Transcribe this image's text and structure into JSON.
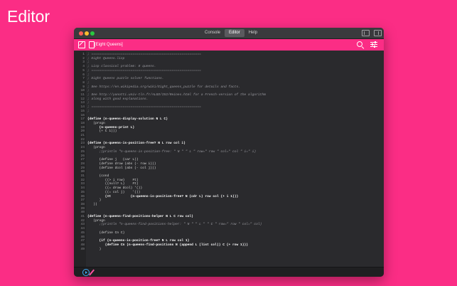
{
  "page": {
    "title": "Editor"
  },
  "window": {
    "tabs": [
      "Console",
      "Editor",
      "Help"
    ],
    "active_tab": "Editor",
    "document_title": "[Eight Queens]"
  },
  "colors": {
    "background": "#fb2d85",
    "window": "#2a2a2d",
    "accent": "#fb2d85",
    "run": "#3fa9f5"
  },
  "icons": {
    "toolbar_left": [
      "edit-icon",
      "file-icon"
    ],
    "toolbar_right": [
      "search-icon",
      "sliders-icon"
    ],
    "titlebar_right": [
      "sidebar-left-icon",
      "sidebar-right-icon"
    ],
    "status": [
      "play-icon",
      "pencil-icon"
    ]
  },
  "code_lines": [
    {
      "n": "1",
      "text": "; ========================================================",
      "kind": "comment"
    },
    {
      "n": "2",
      "text": "; Eight Queens.lisp",
      "kind": "comment"
    },
    {
      "n": "3",
      "text": ";",
      "kind": "comment"
    },
    {
      "n": "4",
      "text": "; Lisp classical problem: 8 queens.",
      "kind": "comment"
    },
    {
      "n": "5",
      "text": "; ========================================================",
      "kind": "comment"
    },
    {
      "n": "6",
      "text": ";",
      "kind": "comment"
    },
    {
      "n": "7",
      "text": "; Eight Queens puzzle solver functions.",
      "kind": "comment"
    },
    {
      "n": "8",
      "text": ";",
      "kind": "comment"
    },
    {
      "n": "9",
      "text": "; See https://en.wikipedia.org/wiki/Eight_queens_puzzle for details and facts.",
      "kind": "comment"
    },
    {
      "n": "10",
      "text": ";",
      "kind": "comment"
    },
    {
      "n": "11",
      "text": "; See http://yanotti.univ-tln.fr/ALGO/I52/Reines.html for a French-version of the algorithm",
      "kind": "comment"
    },
    {
      "n": "12",
      "text": "; along with good explanations.",
      "kind": "comment"
    },
    {
      "n": "13",
      "text": ";",
      "kind": "comment"
    },
    {
      "n": "14",
      "text": "; ========================================================",
      "kind": "comment"
    },
    {
      "n": "15",
      "text": ";",
      "kind": "comment"
    },
    {
      "n": "16",
      "text": "",
      "kind": "plain"
    },
    {
      "n": "17",
      "text": "(define (n-queens-display-solution N L C)",
      "kind": "def"
    },
    {
      "n": "18",
      "text": "   (progn",
      "kind": "plain"
    },
    {
      "n": "19",
      "text": "      (n-queens-print L)",
      "kind": "def"
    },
    {
      "n": "20",
      "text": "      (+ C 1)))",
      "kind": "plain"
    },
    {
      "n": "21",
      "text": "",
      "kind": "plain"
    },
    {
      "n": "22",
      "text": "",
      "kind": "plain"
    },
    {
      "n": "23",
      "text": "(define (n-queens-is-position-free? N L row col i)",
      "kind": "def"
    },
    {
      "n": "24",
      "text": "   (progn",
      "kind": "plain"
    },
    {
      "n": "25",
      "text": "      ;(println \"n-queens-is-position-free: \" N \" \" L \" row=\" row \" col=\" col \" i=\" i)",
      "kind": "comment"
    },
    {
      "n": "26",
      "text": "",
      "kind": "plain"
    },
    {
      "n": "27",
      "text": "      (define j   (car L))",
      "kind": "plain"
    },
    {
      "n": "28",
      "text": "      (define drow (abs (- row i)))",
      "kind": "plain"
    },
    {
      "n": "29",
      "text": "      (define dcol (abs (- col j)))",
      "kind": "plain"
    },
    {
      "n": "30",
      "text": "",
      "kind": "plain"
    },
    {
      "n": "31",
      "text": "      (cond",
      "kind": "plain"
    },
    {
      "n": "32",
      "text": "         ((> i row)    #t)",
      "kind": "plain"
    },
    {
      "n": "33",
      "text": "         ((null? L)    #t)",
      "kind": "plain"
    },
    {
      "n": "34",
      "text": "         ((= drow dcol) '())",
      "kind": "plain"
    },
    {
      "n": "35",
      "text": "         ((= col j)    '())",
      "kind": "plain"
    },
    {
      "n": "36",
      "text": "         (#t          (n-queens-is-position-free? N (cdr L) row col (+ i 1)))",
      "kind": "def"
    },
    {
      "n": "37",
      "text": "      )",
      "kind": "plain"
    },
    {
      "n": "38",
      "text": "   ))",
      "kind": "plain"
    },
    {
      "n": "39",
      "text": "",
      "kind": "plain"
    },
    {
      "n": "40",
      "text": "",
      "kind": "plain"
    },
    {
      "n": "41",
      "text": "(define (n-queens-find-positions-helper N L C row col)",
      "kind": "def"
    },
    {
      "n": "42",
      "text": "   (progn",
      "kind": "plain"
    },
    {
      "n": "43",
      "text": "      ;(println \"n-queens-find-positions-helper: \" N \" \" L \" \" C \" row=\" row \" col=\" col)",
      "kind": "comment"
    },
    {
      "n": "44",
      "text": "",
      "kind": "plain"
    },
    {
      "n": "45",
      "text": "      (define Cn C)",
      "kind": "plain"
    },
    {
      "n": "46",
      "text": "",
      "kind": "plain"
    },
    {
      "n": "47",
      "text": "      (if (n-queens-is-position-free? N L row col 1)",
      "kind": "def"
    },
    {
      "n": "48",
      "text": "         (define Cn (n-queens-find-positions N (append L (list col)) C (+ row 1)))",
      "kind": "def"
    },
    {
      "n": "49",
      "text": "      )",
      "kind": "plain"
    }
  ]
}
